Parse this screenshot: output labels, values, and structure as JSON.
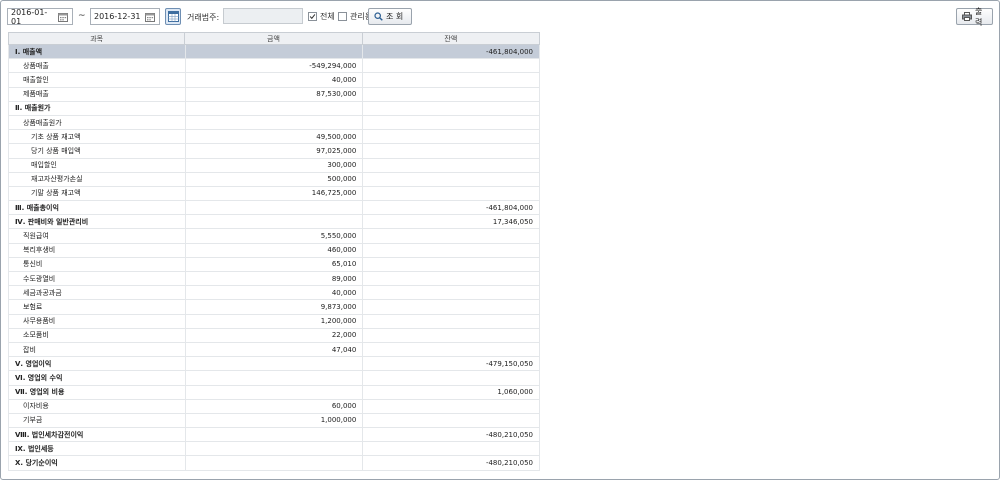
{
  "toolbar": {
    "date_from": "2016-01-01",
    "date_to": "2016-12-31",
    "range_sep": "~",
    "client_label": "거래범주:",
    "client_value": "",
    "all_label": "전체",
    "all_checked": true,
    "manage_label": "관리용",
    "manage_checked": false,
    "search_label": "조 회",
    "print_label": "출 력"
  },
  "table": {
    "columns": [
      "과목",
      "금액",
      "잔액"
    ],
    "rows": [
      {
        "subject": "Ⅰ. 매출액",
        "amount": "",
        "balance": "-461,804,000",
        "level": 0,
        "selected": true
      },
      {
        "subject": "상품매출",
        "amount": "-549,294,000",
        "balance": "",
        "level": 1
      },
      {
        "subject": "매출할인",
        "amount": "40,000",
        "balance": "",
        "level": 1
      },
      {
        "subject": "제품매출",
        "amount": "87,530,000",
        "balance": "",
        "level": 1
      },
      {
        "subject": "Ⅱ. 매출원가",
        "amount": "",
        "balance": "",
        "level": 0
      },
      {
        "subject": "상품매출원가",
        "amount": "",
        "balance": "",
        "level": 1
      },
      {
        "subject": "기초 상품 재고액",
        "amount": "49,500,000",
        "balance": "",
        "level": 2
      },
      {
        "subject": "당기 상품 매입액",
        "amount": "97,025,000",
        "balance": "",
        "level": 2
      },
      {
        "subject": "매입할인",
        "amount": "300,000",
        "balance": "",
        "level": 2
      },
      {
        "subject": "재고자산평가손실",
        "amount": "500,000",
        "balance": "",
        "level": 2
      },
      {
        "subject": "기말 상품 재고액",
        "amount": "146,725,000",
        "balance": "",
        "level": 2
      },
      {
        "subject": "Ⅲ. 매출총이익",
        "amount": "",
        "balance": "-461,804,000",
        "level": 0
      },
      {
        "subject": "Ⅳ. 판매비와 일반관리비",
        "amount": "",
        "balance": "17,346,050",
        "level": 0
      },
      {
        "subject": "직원급여",
        "amount": "5,550,000",
        "balance": "",
        "level": 1
      },
      {
        "subject": "복리후생비",
        "amount": "460,000",
        "balance": "",
        "level": 1
      },
      {
        "subject": "통신비",
        "amount": "65,010",
        "balance": "",
        "level": 1
      },
      {
        "subject": "수도광열비",
        "amount": "89,000",
        "balance": "",
        "level": 1
      },
      {
        "subject": "세금과공과금",
        "amount": "40,000",
        "balance": "",
        "level": 1
      },
      {
        "subject": "보험료",
        "amount": "9,873,000",
        "balance": "",
        "level": 1
      },
      {
        "subject": "사무용품비",
        "amount": "1,200,000",
        "balance": "",
        "level": 1
      },
      {
        "subject": "소모품비",
        "amount": "22,000",
        "balance": "",
        "level": 1
      },
      {
        "subject": "잡비",
        "amount": "47,040",
        "balance": "",
        "level": 1
      },
      {
        "subject": "Ⅴ. 영업이익",
        "amount": "",
        "balance": "-479,150,050",
        "level": 0
      },
      {
        "subject": "Ⅵ. 영업외 수익",
        "amount": "",
        "balance": "",
        "level": 0
      },
      {
        "subject": "Ⅶ. 영업외 비용",
        "amount": "",
        "balance": "1,060,000",
        "level": 0
      },
      {
        "subject": "이자비용",
        "amount": "60,000",
        "balance": "",
        "level": 1
      },
      {
        "subject": "기부금",
        "amount": "1,000,000",
        "balance": "",
        "level": 1
      },
      {
        "subject": "Ⅷ. 법인세차감전이익",
        "amount": "",
        "balance": "-480,210,050",
        "level": 0
      },
      {
        "subject": "Ⅸ. 법인세등",
        "amount": "",
        "balance": "",
        "level": 0
      },
      {
        "subject": "Ⅹ. 당기순이익",
        "amount": "",
        "balance": "-480,210,050",
        "level": 0
      }
    ]
  },
  "colors": {
    "selected_row": "#c4ccd8",
    "header_bg": "#eef0f3",
    "border": "#9aa3ad"
  }
}
